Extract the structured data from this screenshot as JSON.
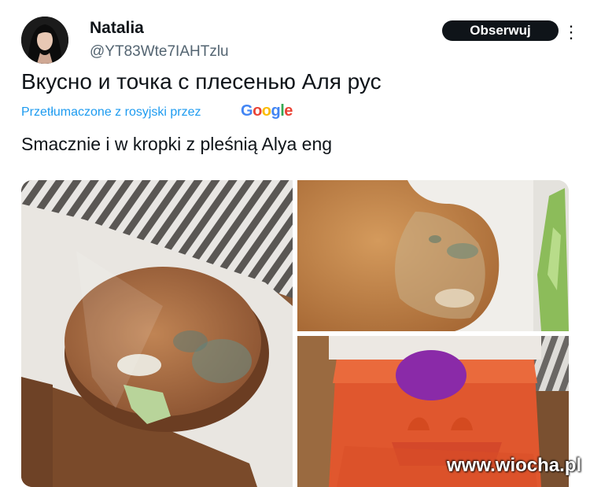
{
  "tweet": {
    "author_name": "Natalia",
    "author_handle": "@YT83Wte7IAHTzlu",
    "follow_label": "Obserwuj",
    "more_icon": "more-horizontal-icon",
    "text_original": "Вкусно и точка с плесенью Аля рус",
    "translated_label": "Przetłumaczone z rosyjski przez",
    "translation_provider": "Google",
    "text_translated": "Smacznie i w kropki z pleśnią Alya eng"
  },
  "watermark": "www.wiocha.pl",
  "colors": {
    "link_blue": "#1d9bf0",
    "button_bg": "#0f1419",
    "secondary_text": "#536471"
  }
}
